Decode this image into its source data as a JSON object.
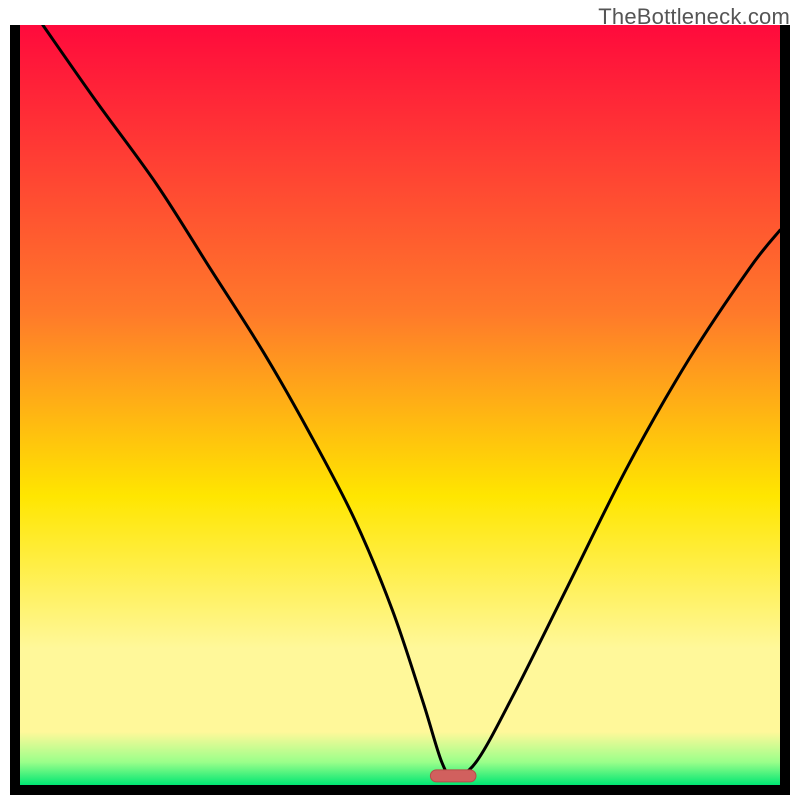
{
  "watermark": "TheBottleneck.com",
  "colors": {
    "gradient_top": "#ff0a3c",
    "gradient_mid_upper": "#ff7a2a",
    "gradient_mid": "#ffe600",
    "gradient_lower": "#fff89a",
    "gradient_green_light": "#9aff8a",
    "gradient_green": "#00e673",
    "border": "#000000",
    "curve": "#000000",
    "marker_fill": "#d1605e",
    "marker_stroke": "#b84a48"
  },
  "chart_data": {
    "type": "line",
    "title": "",
    "xlabel": "",
    "ylabel": "",
    "xlim": [
      0,
      100
    ],
    "ylim": [
      0,
      100
    ],
    "notes": "V-shaped bottleneck curve over vertical red→yellow→green gradient. Minimum around x≈57. No axis tick labels are visible in the source image, so x/y are read on a 0–100 normalized scale estimated from pixel position.",
    "series": [
      {
        "name": "bottleneck-curve",
        "x": [
          3,
          10,
          18,
          25,
          32,
          38,
          44,
          49,
          53,
          55.5,
          57,
          60,
          65,
          72,
          80,
          88,
          96,
          100
        ],
        "y": [
          100,
          90,
          79,
          68,
          57,
          46.5,
          35,
          23,
          11,
          3,
          1.2,
          3,
          12,
          26,
          42,
          56,
          68,
          73
        ]
      }
    ],
    "marker": {
      "x": 57,
      "y": 1.2,
      "width": 6,
      "shape": "pill"
    }
  }
}
